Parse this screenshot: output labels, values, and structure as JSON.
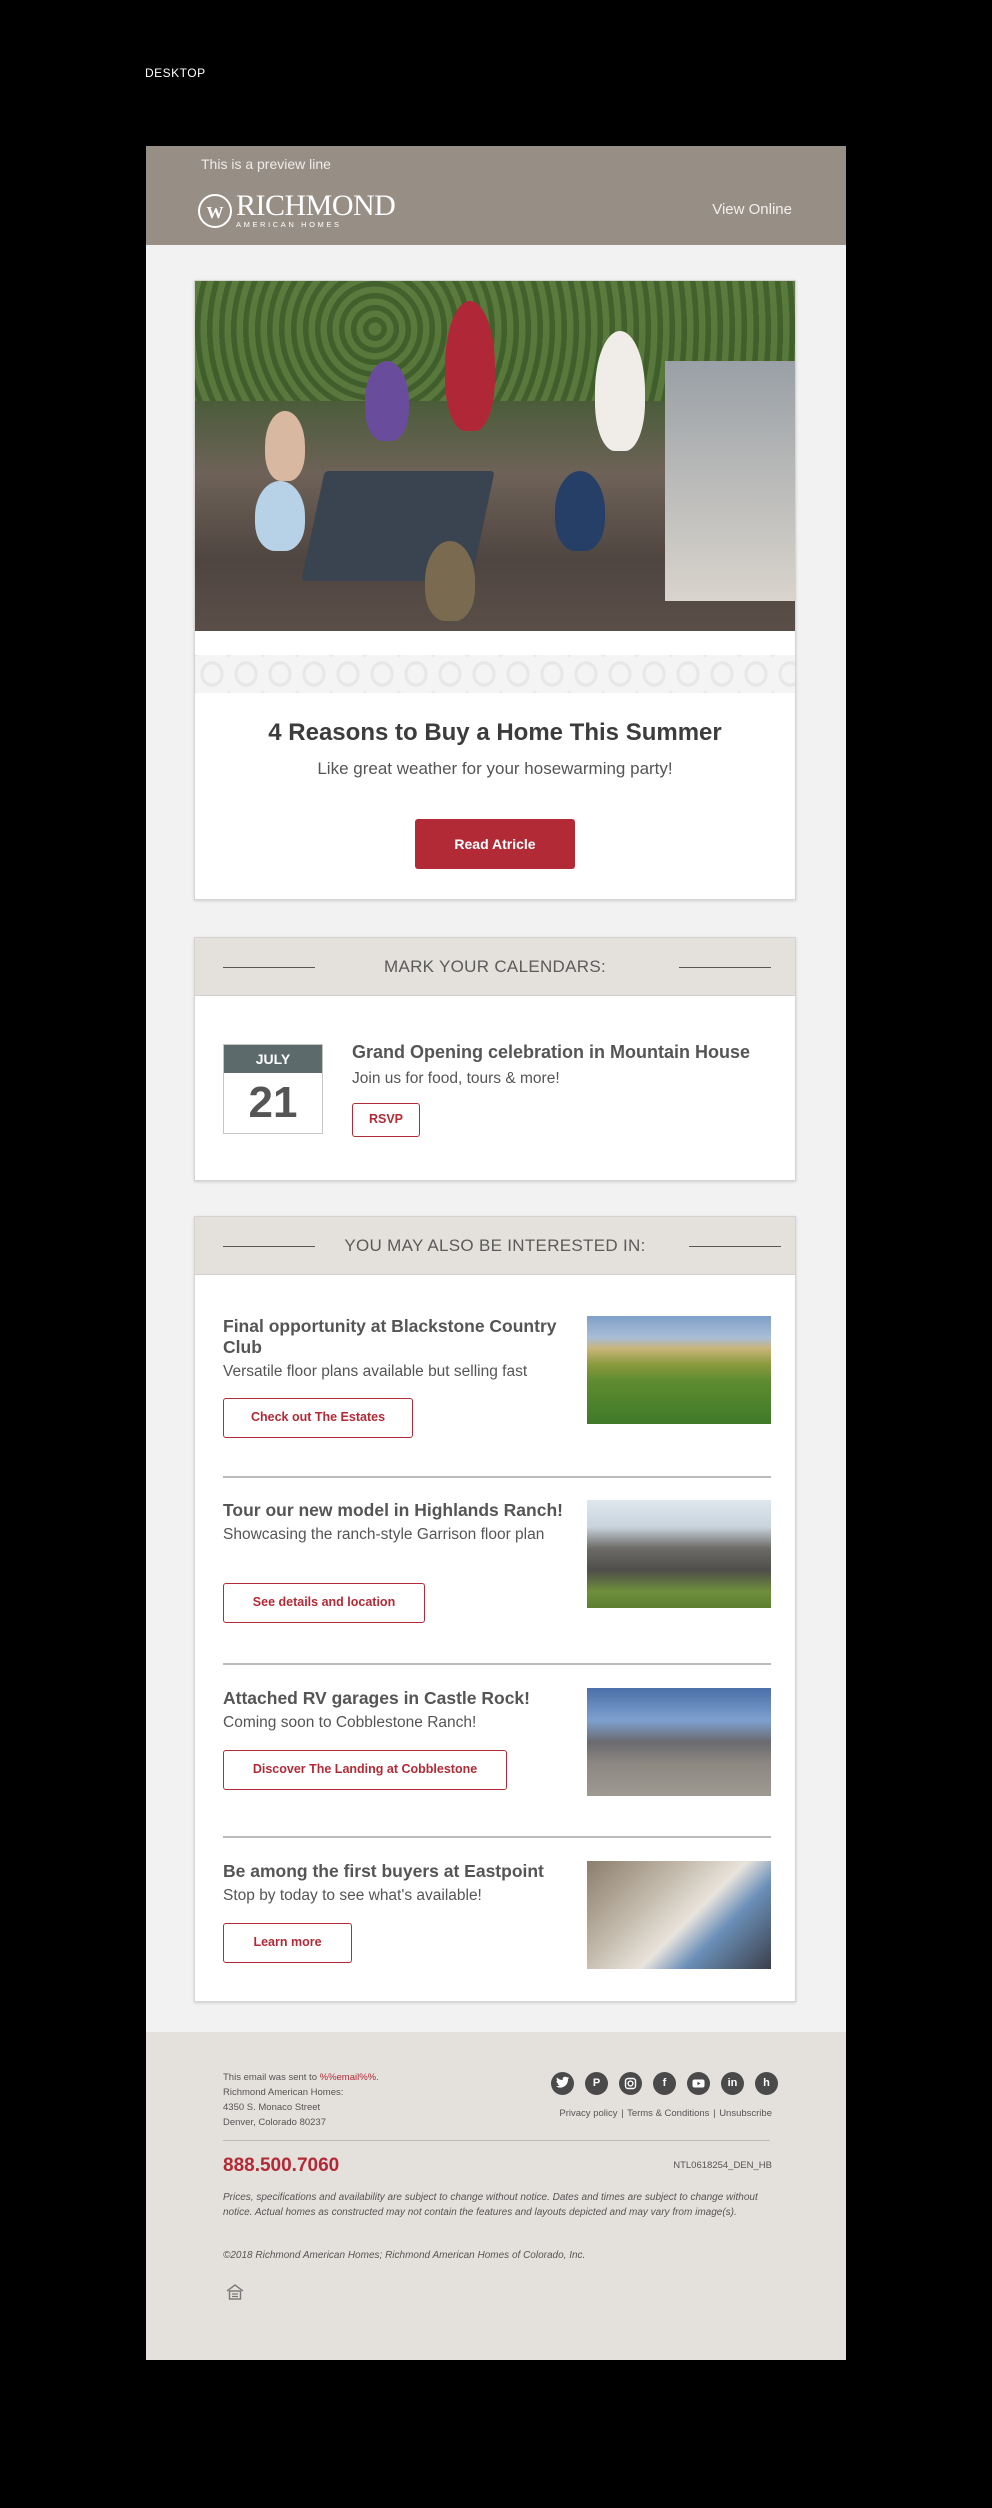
{
  "page_label": "DESKTOP",
  "header": {
    "preview_line": "This is a preview line",
    "logo_name": "RICHMOND",
    "logo_tagline": "AMERICAN HOMES",
    "view_online": "View Online"
  },
  "hero": {
    "title": "4 Reasons to Buy a Home This Summer",
    "subtitle": "Like great weather for your hosewarming party!",
    "button": "Read Atricle"
  },
  "calendar": {
    "section_title": "MARK YOUR CALENDARS:",
    "month": "JULY",
    "day": "21",
    "event_title": "Grand Opening celebration in Mountain House",
    "event_sub": "Join us for food, tours & more!",
    "button": "RSVP"
  },
  "interest": {
    "section_title": "YOU MAY ALSO BE INTERESTED IN:",
    "items": [
      {
        "title": "Final opportunity at Blackstone Country Club",
        "subtitle": "Versatile floor plans available but selling fast",
        "button": "Check out The Estates",
        "image": "golf-course-photo"
      },
      {
        "title": "Tour our new model in Highlands Ranch!",
        "subtitle": "Showcasing the ranch-style Garrison floor plan",
        "button": "See details and location",
        "image": "model-home-photo"
      },
      {
        "title": "Attached RV garages in Castle Rock!",
        "subtitle": "Coming soon to Cobblestone Ranch!",
        "button": "Discover The Landing at Cobblestone",
        "image": "rv-garage-home-photo"
      },
      {
        "title": "Be among the first buyers at Eastpoint",
        "subtitle": "Stop by today to see what's available!",
        "button": "Learn more",
        "image": "interior-living-room-photo"
      }
    ]
  },
  "footer": {
    "sent_to_prefix": "This email was sent to ",
    "sent_to_email": "%%email%%",
    "sent_to_suffix": ".",
    "company": "Richmond American Homes:",
    "street": "4350 S. Monaco Street",
    "city": "Denver, Colorado 80237",
    "socials": [
      "twitter-icon",
      "pinterest-icon",
      "instagram-icon",
      "facebook-icon",
      "youtube-icon",
      "linkedin-icon",
      "houzz-icon"
    ],
    "privacy": "Privacy policy",
    "terms": "Terms & Conditions",
    "unsubscribe": "Unsubscribe",
    "separator": "|",
    "phone": "888.500.7060",
    "code": "NTL0618254_DEN_HB",
    "disclaimer": "Prices, specifications and availability are subject to change without notice. Dates and times are subject to change without notice. Actual homes as constructed may not contain the features and layouts depicted and may vary from image(s).",
    "copyright": "©2018 Richmond American Homes; Richmond American Homes of Colorado, Inc."
  }
}
